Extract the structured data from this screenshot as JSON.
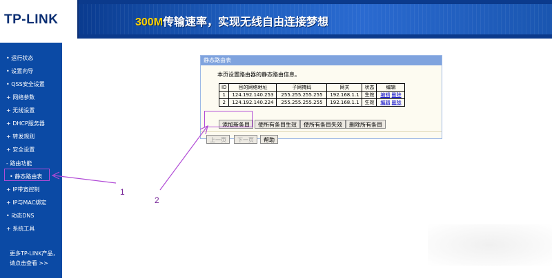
{
  "header": {
    "logo": "TP-LINK",
    "slogan_accent": "300M",
    "slogan_rest": "传输速率，实现无线自由连接梦想"
  },
  "sidebar": {
    "items": [
      {
        "label": "• 运行状态"
      },
      {
        "label": "• 设置向导"
      },
      {
        "label": "• QSS安全设置"
      },
      {
        "label": "+ 网络参数"
      },
      {
        "label": "+ 无线设置"
      },
      {
        "label": "+ DHCP服务器"
      },
      {
        "label": "+ 转发规则"
      },
      {
        "label": "+ 安全设置"
      },
      {
        "label": "- 路由功能"
      },
      {
        "label": "• 静态路由表"
      },
      {
        "label": "+ IP带宽控制"
      },
      {
        "label": "+ IP与MAC绑定"
      },
      {
        "label": "• 动态DNS"
      },
      {
        "label": "+ 系统工具"
      }
    ],
    "footer_line1": "更多TP-LINK产品，",
    "footer_line2": "请点击查看 >>"
  },
  "panel": {
    "title": "静态路由表",
    "description": "本页设置路由器的静态路由信息。",
    "columns": [
      "ID",
      "目的网络地址",
      "子网掩码",
      "网关",
      "状态",
      "编辑"
    ],
    "rows": [
      {
        "id": "1",
        "dest": "124.192.140.253",
        "mask": "255.255.255.255",
        "gateway": "192.168.1.1",
        "status": "生效",
        "edit": "编辑",
        "delete": "删除"
      },
      {
        "id": "2",
        "dest": "124.192.140.224",
        "mask": "255.255.255.255",
        "gateway": "192.168.1.1",
        "status": "生效",
        "edit": "编辑",
        "delete": "删除"
      }
    ],
    "buttons": {
      "add": "添加新条目",
      "enable_all": "使所有条目生效",
      "disable_all": "使所有条目失效",
      "delete_all": "删除所有条目",
      "prev": "上一页",
      "next": "下一页",
      "help": "帮助"
    }
  },
  "annotations": {
    "label1": "1",
    "label2": "2",
    "color": "#b14bd6"
  }
}
